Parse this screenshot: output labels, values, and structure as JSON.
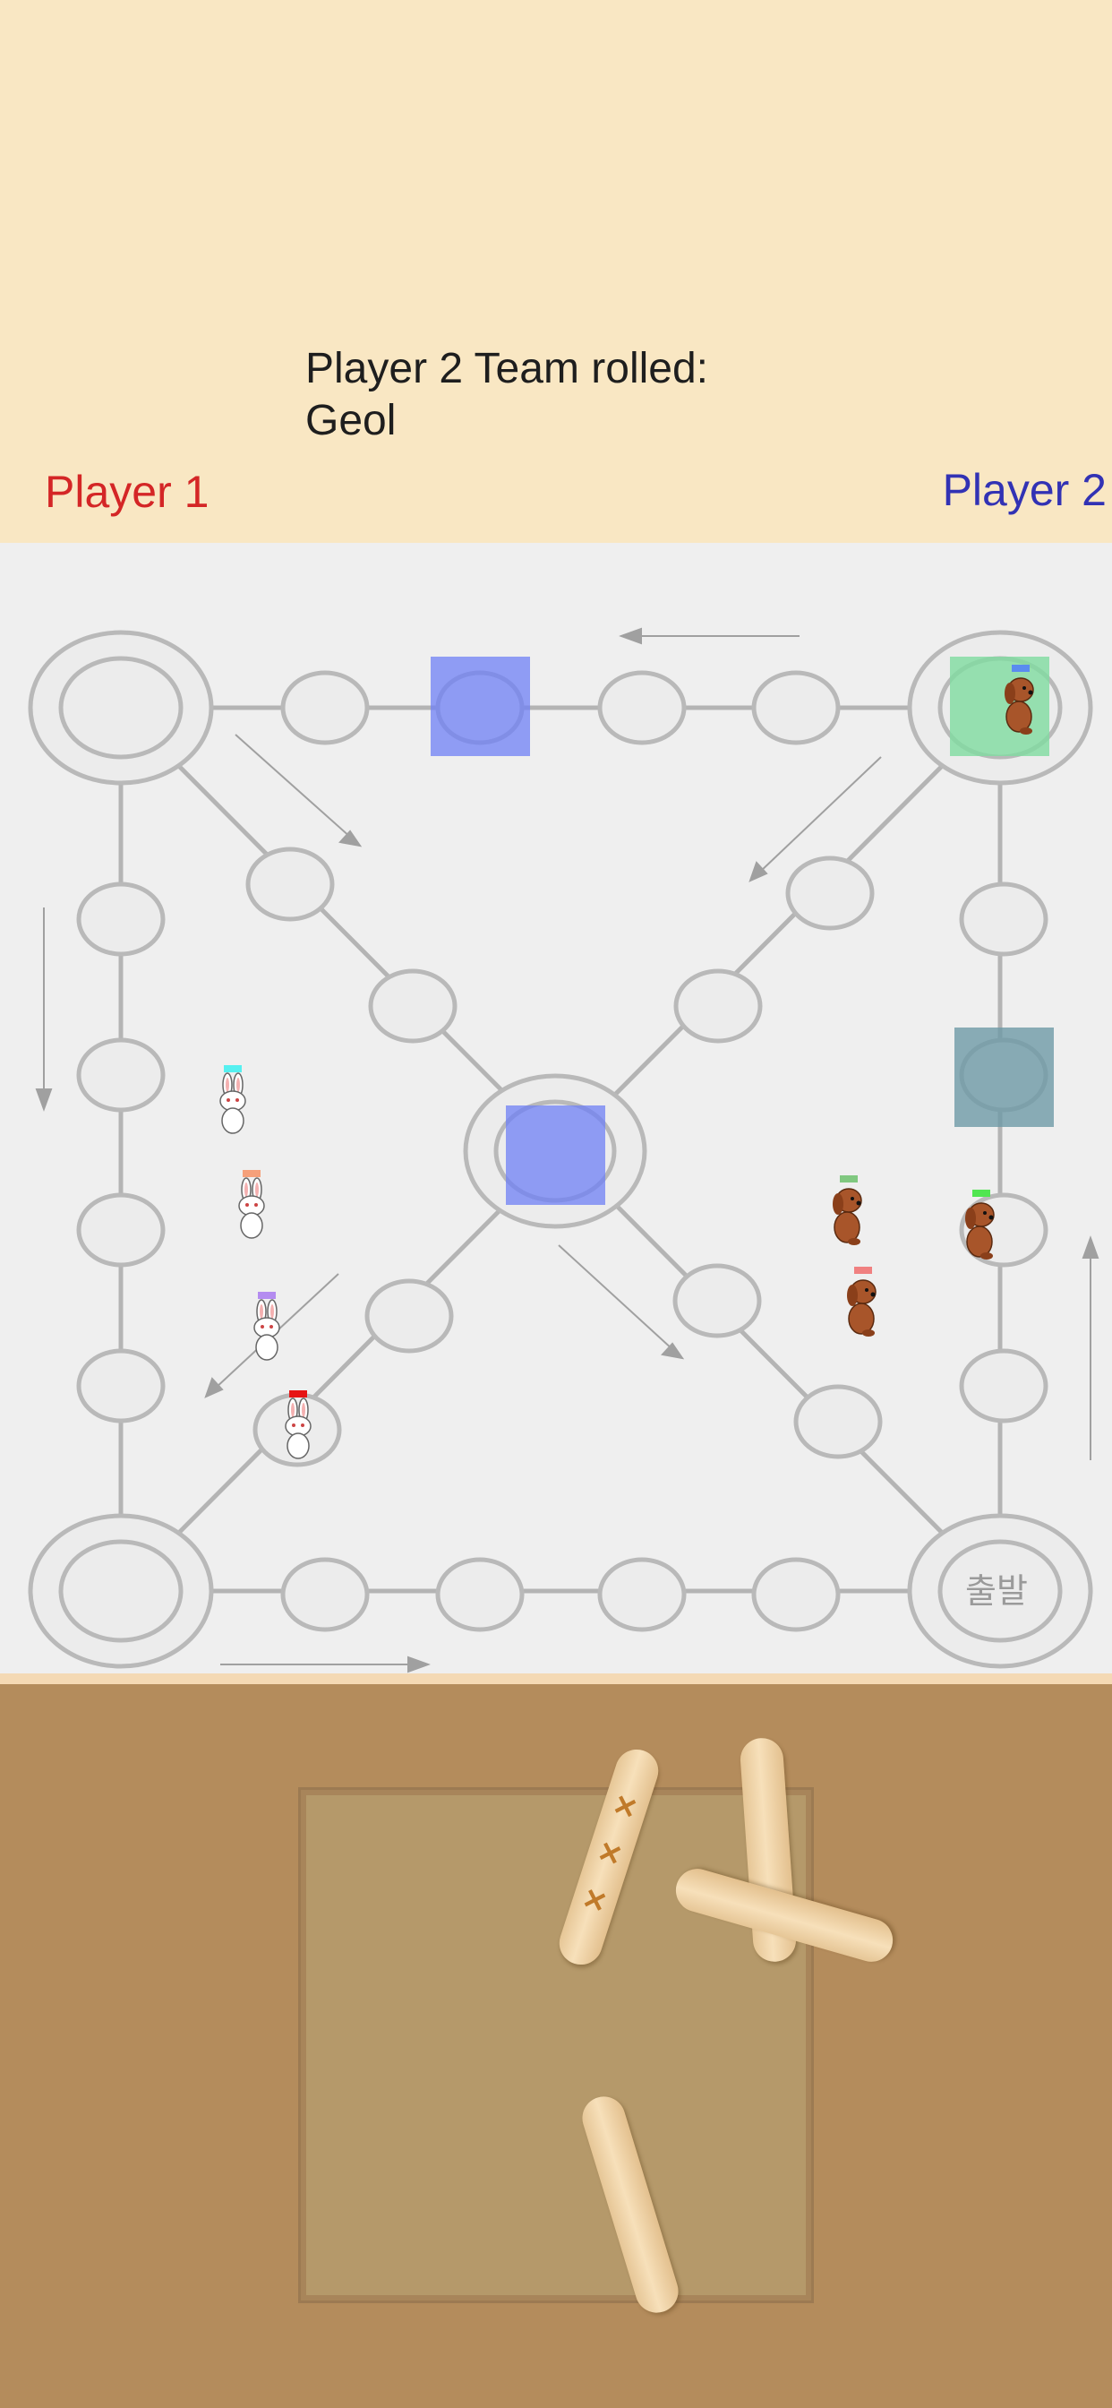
{
  "status": {
    "line1": "Player 2 Team rolled:",
    "line2": "Geol"
  },
  "players": {
    "p1": "Player 1",
    "p2": "Player 2"
  },
  "colors": {
    "player1": "#d42626",
    "player2": "#3232b4",
    "highlight_blue": "#6f80f5",
    "highlight_green": "#80dca0",
    "highlight_teal": "#6e9aa6"
  },
  "board": {
    "start_label": "출발"
  },
  "pieces": {
    "player1_team": "rabbit",
    "player2_team": "dog",
    "rabbit_flags": [
      "#56f0f0",
      "#f5a07a",
      "#b48cf0",
      "#e61414"
    ],
    "dog_flags": [
      "#5a8cf0",
      "#80c880",
      "#50e650",
      "#f08080"
    ]
  },
  "sticks": {
    "count": 4,
    "marked_stick_marks": [
      "✕",
      "✕",
      "✕"
    ]
  }
}
